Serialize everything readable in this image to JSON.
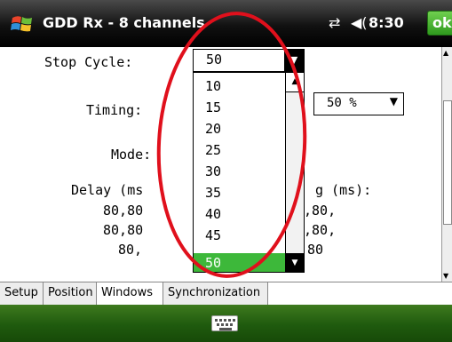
{
  "titlebar": {
    "title": "GDD Rx - 8 channels",
    "clock": "8:30",
    "ok_label": "ok",
    "signal_icon": "⇄",
    "volume_icon": "◀("
  },
  "form": {
    "stop_cycle_label": "Stop Cycle:",
    "stop_cycle_value": "50",
    "timing_label": "Timing:",
    "timing_value": "50 %",
    "mode_label": "Mode:",
    "delay_label": "Delay (ms",
    "delay_rows": [
      "80,80",
      "80,80",
      "80,"
    ],
    "width_label": "g (ms):",
    "width_rows": [
      ",80,",
      ",80,",
      "80"
    ]
  },
  "dropdown": {
    "options": [
      "10",
      "15",
      "20",
      "25",
      "30",
      "35",
      "40",
      "45",
      "50"
    ],
    "selected": "50"
  },
  "tabs": [
    "Setup",
    "Position",
    "Windows",
    "Synchronization"
  ],
  "active_tab": "Windows",
  "colors": {
    "selection": "#3db83a",
    "menubar": "#2a6a14",
    "annotation": "#e0101c"
  }
}
